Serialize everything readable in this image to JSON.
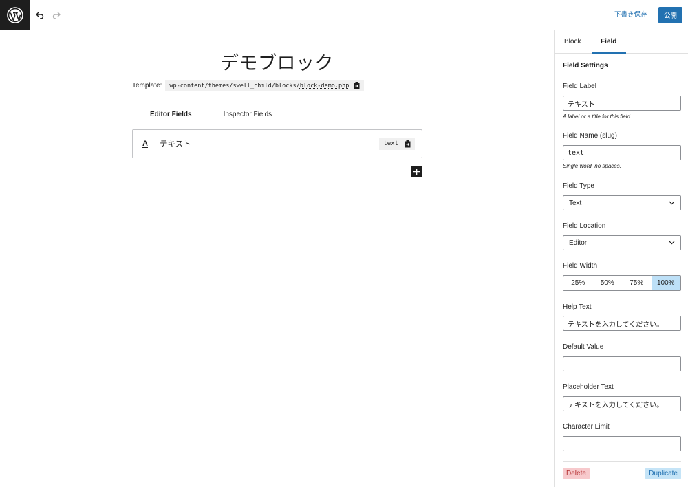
{
  "toolbar": {
    "logo_icon": "wordpress-logo-icon",
    "undo_icon": "undo-icon",
    "redo_icon": "redo-icon",
    "draft_label": "下書き保存",
    "publish_label": "公開",
    "accent_color": "#2271b1"
  },
  "editor": {
    "block_title": "デモブロック",
    "template_label": "Template:",
    "template_dir": "wp-content/themes/swell_child/blocks/",
    "template_file": "block-demo.php",
    "tabs": [
      "Editor Fields",
      "Inspector Fields"
    ],
    "active_tab": "Editor Fields",
    "fields": [
      {
        "type_icon": "A",
        "label": "テキスト",
        "slug": "text"
      }
    ]
  },
  "sidebar": {
    "tabs": [
      "Block",
      "Field"
    ],
    "active_tab": "Field",
    "section_title": "Field Settings",
    "field_label": {
      "label": "Field Label",
      "value": "テキスト",
      "help": "A label or a title for this field."
    },
    "field_name": {
      "label": "Field Name (slug)",
      "value": "text",
      "help": "Single word, no spaces."
    },
    "field_type": {
      "label": "Field Type",
      "value": "Text"
    },
    "field_location": {
      "label": "Field Location",
      "value": "Editor"
    },
    "field_width": {
      "label": "Field Width",
      "options": [
        "25%",
        "50%",
        "75%",
        "100%"
      ],
      "selected": "100%"
    },
    "help_text": {
      "label": "Help Text",
      "value": "テキストを入力してください。"
    },
    "default_value": {
      "label": "Default Value",
      "value": ""
    },
    "placeholder_text": {
      "label": "Placeholder Text",
      "value": "テキストを入力してください。"
    },
    "character_limit": {
      "label": "Character Limit",
      "value": ""
    },
    "delete_label": "Delete",
    "duplicate_label": "Duplicate"
  }
}
